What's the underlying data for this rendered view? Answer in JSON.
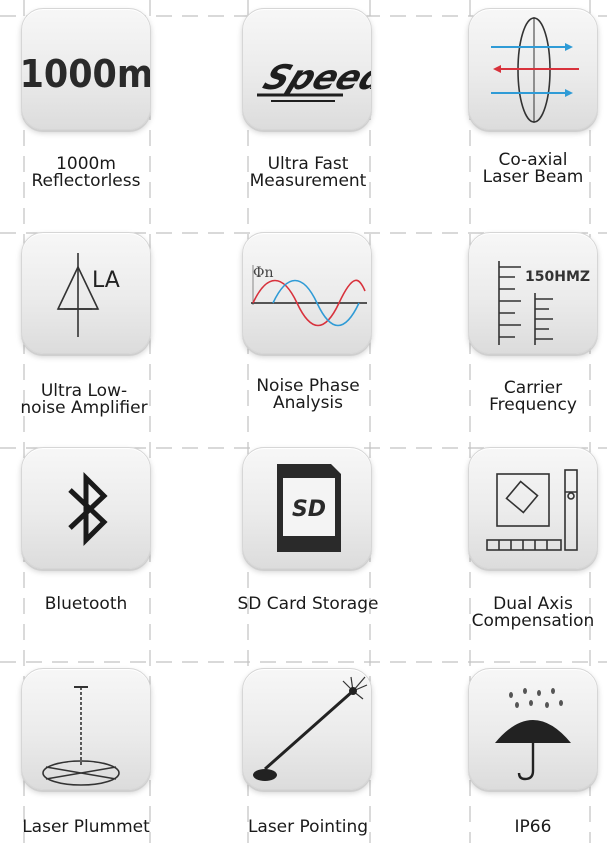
{
  "features": [
    {
      "id": "reflectorless",
      "icon": "range-1000m-icon",
      "icon_text": "1000m",
      "lines": [
        "1000m",
        "Reflectorless"
      ]
    },
    {
      "id": "fast",
      "icon": "speed-icon",
      "icon_text": "Speed",
      "lines": [
        "Ultra Fast",
        "Measurement"
      ]
    },
    {
      "id": "coaxial",
      "icon": "coaxial-beam-icon",
      "lines": [
        "Co-axial",
        "Laser Beam"
      ]
    },
    {
      "id": "amplifier",
      "icon": "amplifier-icon",
      "icon_text": "LA",
      "lines": [
        "Ultra Low-",
        "noise Amplifier"
      ]
    },
    {
      "id": "phase",
      "icon": "phase-wave-icon",
      "icon_text": "Φn",
      "lines": [
        "Noise Phase",
        "Analysis"
      ]
    },
    {
      "id": "carrier",
      "icon": "carrier-frequency-icon",
      "icon_text": "150HMZ",
      "lines": [
        "Carrier",
        "Frequency"
      ]
    },
    {
      "id": "bluetooth",
      "icon": "bluetooth-icon",
      "lines": [
        "Bluetooth"
      ]
    },
    {
      "id": "sdcard",
      "icon": "sd-card-icon",
      "icon_text": "SD",
      "lines": [
        "SD Card Storage"
      ]
    },
    {
      "id": "compensation",
      "icon": "dual-axis-compensation-icon",
      "lines": [
        "Dual Axis",
        "Compensation"
      ]
    },
    {
      "id": "plummet",
      "icon": "laser-plummet-icon",
      "lines": [
        "Laser Plummet"
      ]
    },
    {
      "id": "pointing",
      "icon": "laser-pointing-icon",
      "lines": [
        "Laser Pointing"
      ]
    },
    {
      "id": "ip66",
      "icon": "ip66-rain-umbrella-icon",
      "lines": [
        "IP66"
      ]
    }
  ],
  "colors": {
    "text": "#1a1a1a",
    "beam_blue": "#2f9bd6",
    "beam_red": "#d8323c",
    "guide": "#bdbdbd"
  }
}
